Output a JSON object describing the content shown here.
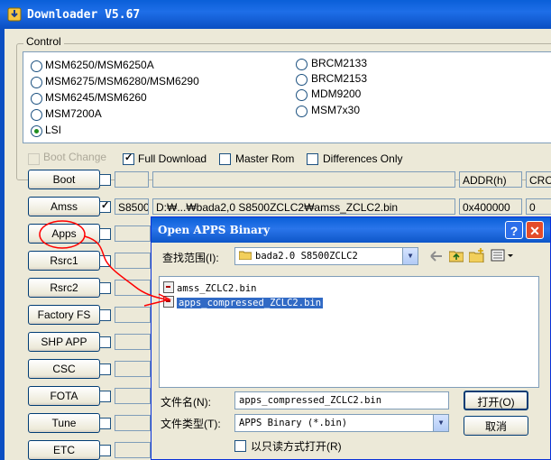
{
  "window": {
    "title": "Downloader V5.67"
  },
  "control": {
    "legend": "Control",
    "chips_left": [
      {
        "label": "MSM6250/MSM6250A",
        "selected": false
      },
      {
        "label": "MSM6275/MSM6280/MSM6290",
        "selected": false
      },
      {
        "label": "MSM6245/MSM6260",
        "selected": false
      },
      {
        "label": "MSM7200A",
        "selected": false
      },
      {
        "label": "LSI",
        "selected": true
      }
    ],
    "chips_right": [
      {
        "label": "BRCM2133",
        "selected": false
      },
      {
        "label": "BRCM2153",
        "selected": false
      },
      {
        "label": "MDM9200",
        "selected": false
      },
      {
        "label": "MSM7x30",
        "selected": false
      }
    ],
    "options": {
      "boot_change": "Boot Change",
      "full_download": "Full Download",
      "master_rom": "Master Rom",
      "differences_only": "Differences Only"
    },
    "columns": {
      "addr": "ADDR(h)",
      "crc": "CRC"
    }
  },
  "images": [
    {
      "button": "Boot",
      "checked": false,
      "model": "",
      "path": "",
      "addr": "",
      "crc": ""
    },
    {
      "button": "Amss",
      "checked": true,
      "model": "S8500",
      "path": "D:₩...₩bada2,0 S8500ZCLC2₩amss_ZCLC2.bin",
      "addr": "0x400000",
      "crc": "0"
    },
    {
      "button": "Apps",
      "checked": false
    },
    {
      "button": "Rsrc1",
      "checked": false
    },
    {
      "button": "Rsrc2",
      "checked": false
    },
    {
      "button": "Factory FS",
      "checked": false
    },
    {
      "button": "SHP APP",
      "checked": false
    },
    {
      "button": "CSC",
      "checked": false
    },
    {
      "button": "FOTA",
      "checked": false
    },
    {
      "button": "Tune",
      "checked": false
    },
    {
      "button": "ETC",
      "checked": false
    }
  ],
  "dialog": {
    "title": "Open APPS Binary",
    "help_icon": "?",
    "look_in_label": "查找范围(I):",
    "look_in_value": "bada2.0 S8500ZCLC2",
    "files": [
      {
        "name": "amss_ZCLC2.bin",
        "selected": false
      },
      {
        "name": "apps_compressed_ZCLC2.bin",
        "selected": true
      }
    ],
    "filename_label": "文件名(N):",
    "filename_value": "apps_compressed_ZCLC2.bin",
    "filetype_label": "文件类型(T):",
    "filetype_value": "APPS Binary (*.bin)",
    "readonly_label": "以只读方式打开(R)",
    "open_button": "打开(O)",
    "cancel_button": "取消"
  },
  "colors": {
    "titlebar": "#0a5fd8",
    "selection": "#316ac5",
    "annotation": "#ff0000"
  }
}
